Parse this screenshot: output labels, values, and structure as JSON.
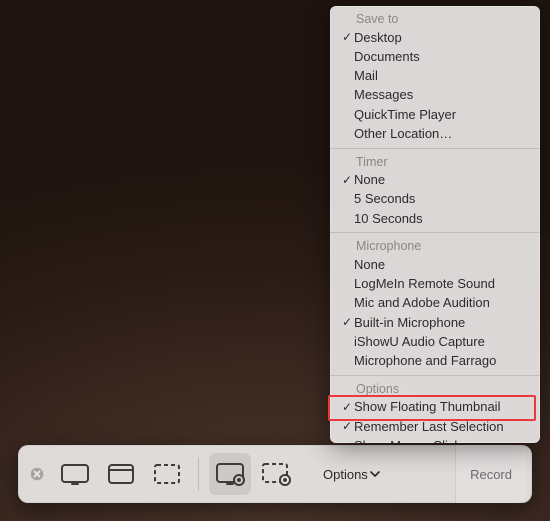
{
  "menu": {
    "sections": [
      {
        "title": "Save to",
        "items": [
          {
            "label": "Desktop",
            "checked": true
          },
          {
            "label": "Documents",
            "checked": false
          },
          {
            "label": "Mail",
            "checked": false
          },
          {
            "label": "Messages",
            "checked": false
          },
          {
            "label": "QuickTime Player",
            "checked": false
          },
          {
            "label": "Other Location…",
            "checked": false
          }
        ]
      },
      {
        "title": "Timer",
        "items": [
          {
            "label": "None",
            "checked": true
          },
          {
            "label": "5 Seconds",
            "checked": false
          },
          {
            "label": "10 Seconds",
            "checked": false
          }
        ]
      },
      {
        "title": "Microphone",
        "items": [
          {
            "label": "None",
            "checked": false
          },
          {
            "label": "LogMeIn Remote Sound",
            "checked": false
          },
          {
            "label": "Mic and Adobe Audition",
            "checked": false
          },
          {
            "label": "Built-in Microphone",
            "checked": true
          },
          {
            "label": "iShowU Audio Capture",
            "checked": false
          },
          {
            "label": "Microphone and Farrago",
            "checked": false
          }
        ]
      },
      {
        "title": "Options",
        "items": [
          {
            "label": "Show Floating Thumbnail",
            "checked": true
          },
          {
            "label": "Remember Last Selection",
            "checked": true
          },
          {
            "label": "Show Mouse Clicks",
            "checked": false
          }
        ]
      }
    ]
  },
  "toolbar": {
    "options_label": "Options",
    "record_label": "Record"
  }
}
